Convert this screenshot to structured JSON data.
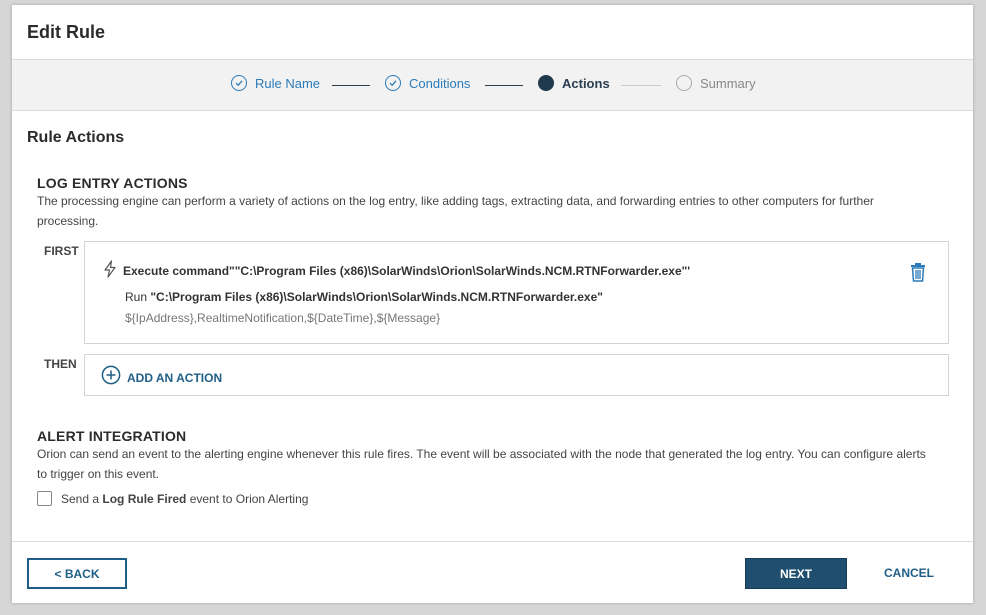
{
  "dialog": {
    "title": "Edit Rule"
  },
  "stepper": {
    "steps": [
      {
        "label": "Rule Name",
        "state": "done"
      },
      {
        "label": "Conditions",
        "state": "done"
      },
      {
        "label": "Actions",
        "state": "active"
      },
      {
        "label": "Summary",
        "state": "todo"
      }
    ]
  },
  "section": {
    "title": "Rule Actions"
  },
  "log_entry": {
    "heading": "LOG ENTRY ACTIONS",
    "description": "The processing engine can perform a variety of actions on the log entry, like adding tags, extracting data, and forwarding entries to other computers for further processing.",
    "first_label": "FIRST",
    "then_label": "THEN",
    "action": {
      "icon": "lightning-icon",
      "title": "Execute command\"\"C:\\Program Files (x86)\\SolarWinds\\Orion\\SolarWinds.NCM.RTNForwarder.exe\"'",
      "run_prefix": "Run ",
      "run_command": "\"C:\\Program Files (x86)\\SolarWinds\\Orion\\SolarWinds.NCM.RTNForwarder.exe\"",
      "params": "${IpAddress},RealtimeNotification,${DateTime},${Message}"
    },
    "add_action_label": "ADD AN ACTION"
  },
  "alert": {
    "heading": "ALERT INTEGRATION",
    "description": "Orion can send an event to the alerting engine whenever this rule fires. The event will be associated with the node that generated the log entry. You can configure alerts to trigger on this event.",
    "checkbox_prefix": "Send a ",
    "checkbox_bold": "Log Rule Fired",
    "checkbox_suffix": " event to Orion Alerting",
    "checked": false
  },
  "footer": {
    "back_label": "< BACK",
    "next_label": "NEXT",
    "cancel_label": "CANCEL"
  },
  "colors": {
    "accent": "#1f5e86",
    "step_done": "#2b7bb9",
    "step_active": "#1f3a4d",
    "next_bg": "#1f4e6e"
  }
}
